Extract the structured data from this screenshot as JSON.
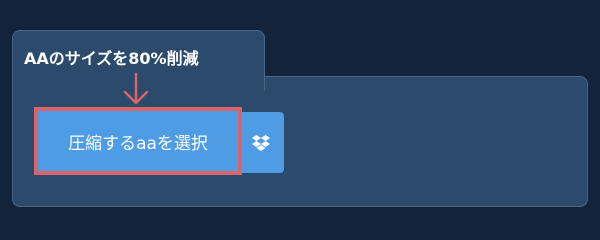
{
  "tab": {
    "title": "AAのサイズを80%削減"
  },
  "upload": {
    "select_label": "圧縮するaaを選択",
    "dropbox_icon": "dropbox-icon"
  },
  "colors": {
    "background": "#13233a",
    "panel": "#2b4a6c",
    "button": "#4e9ce6",
    "highlight": "#d9646a"
  }
}
